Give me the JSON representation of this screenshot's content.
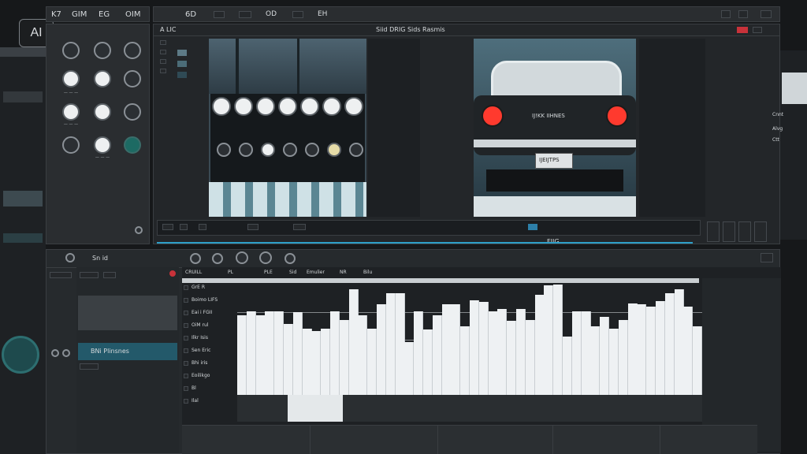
{
  "watermark": "AI",
  "menu": [
    "K7",
    "GIM",
    "EG",
    "OIM"
  ],
  "toolbar": [
    "6D",
    "OD",
    "EH"
  ],
  "viewer": {
    "left_title": "A LIC",
    "center_title": "Siid DRIG Sids Rasmis",
    "car_text": "IJ!KK IIHNES",
    "plate": "IJEIJTPS",
    "timecode": "FIIG"
  },
  "right_tabs": [
    "Cnnt",
    "Alvg",
    "Ctt"
  ],
  "sequence": {
    "tab": "Sn id",
    "toolbar_labels": [
      "CRUILL",
      "PL",
      "PLE",
      "Sid",
      "Emulier",
      "NR",
      "Bilu"
    ],
    "clip_label": "BNi Plinsnes",
    "track_labels": [
      "GrE R",
      "Boimo LIFS",
      "Eai i FGII",
      "OiM rul",
      "Ilkr Isis",
      "Sen Eric",
      "Bhi iris",
      "Eoilikgo",
      "Bl",
      "Ilal"
    ],
    "volume_bars": [
      0.72,
      0.76,
      0.72,
      0.76,
      0.76,
      0.64,
      0.75,
      0.6,
      0.58,
      0.6,
      0.76,
      0.68,
      0.96,
      0.72,
      0.6,
      0.82,
      0.92,
      0.92,
      0.48,
      0.76,
      0.59,
      0.72,
      0.82,
      0.82,
      0.62,
      0.86,
      0.84,
      0.76,
      0.78,
      0.67,
      0.78,
      0.68,
      0.91,
      0.99,
      1.0,
      0.53,
      0.76,
      0.76,
      0.62,
      0.71,
      0.6,
      0.68,
      0.83,
      0.82,
      0.8,
      0.85,
      0.92,
      0.96,
      0.8,
      0.62
    ]
  }
}
